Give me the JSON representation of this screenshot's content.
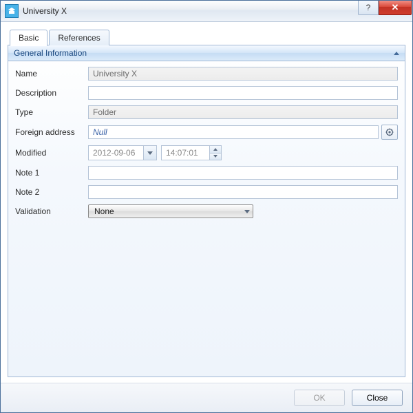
{
  "window": {
    "title": "University X"
  },
  "tabs": {
    "basic": "Basic",
    "references": "References"
  },
  "section": {
    "title": "General Information"
  },
  "labels": {
    "name": "Name",
    "description": "Description",
    "type": "Type",
    "foreign_address": "Foreign address",
    "modified": "Modified",
    "note1": "Note 1",
    "note2": "Note 2",
    "validation": "Validation"
  },
  "values": {
    "name": "University X",
    "description": "",
    "type": "Folder",
    "foreign_address": "Null",
    "modified_date": "2012-09-06",
    "modified_time": "14:07:01",
    "note1": "",
    "note2": "",
    "validation": "None"
  },
  "buttons": {
    "ok": "OK",
    "close": "Close"
  },
  "titlebar_icons": {
    "help": "?",
    "close": "✕"
  }
}
